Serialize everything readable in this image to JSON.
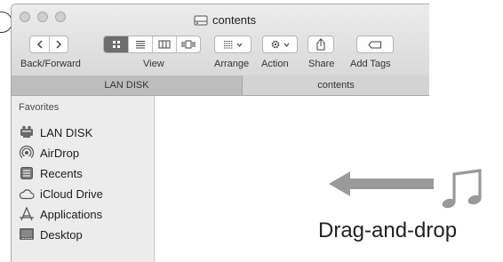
{
  "window": {
    "title": "contents",
    "traffic_lights": [
      "close",
      "minimize",
      "zoom"
    ]
  },
  "toolbar": {
    "back_forward_label": "Back/Forward",
    "view_label": "View",
    "arrange_label": "Arrange",
    "action_label": "Action",
    "share_label": "Share",
    "add_tags_label": "Add Tags",
    "selected_view": "icon"
  },
  "tabs": [
    {
      "label": "LAN DISK",
      "active": true
    },
    {
      "label": "contents",
      "active": false
    }
  ],
  "sidebar": {
    "heading": "Favorites",
    "items": [
      {
        "label": "LAN DISK",
        "icon": "lan-disk-icon"
      },
      {
        "label": "AirDrop",
        "icon": "airdrop-icon"
      },
      {
        "label": "Recents",
        "icon": "recents-icon"
      },
      {
        "label": "iCloud Drive",
        "icon": "icloud-drive-icon"
      },
      {
        "label": "Applications",
        "icon": "applications-icon"
      },
      {
        "label": "Desktop",
        "icon": "desktop-icon"
      }
    ]
  },
  "annotation": {
    "caption": "Drag-and-drop",
    "arrow_direction": "left",
    "file_icon": "music-note-icon",
    "color": "#9a9a9a"
  }
}
